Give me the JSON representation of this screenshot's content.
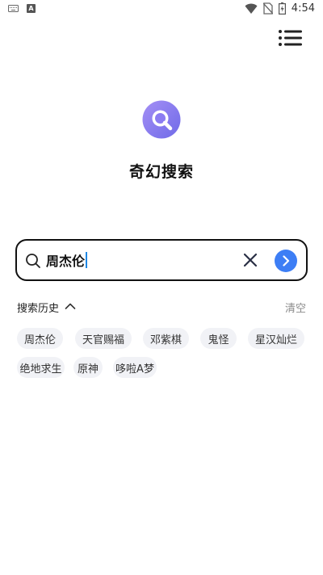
{
  "status_bar": {
    "left_icons": [
      "keyboard-icon",
      "a-icon"
    ],
    "a_icon_text": "A",
    "right_icons": [
      "wifi-icon",
      "no-sim-icon",
      "battery-charging-icon"
    ],
    "time": "4:54"
  },
  "header": {
    "menu_icon": "menu-icon"
  },
  "app": {
    "logo_icon": "search-logo-icon",
    "title": "奇幻搜索",
    "accent_color": "#3d7ef5",
    "logo_color": "#8b7cf2"
  },
  "search": {
    "value": "周杰伦",
    "icon": "search-icon",
    "clear_icon": "close-icon",
    "submit_icon": "arrow-right-icon"
  },
  "history": {
    "title": "搜索历史",
    "toggle_icon": "chevron-up-icon",
    "clear_label": "清空",
    "items": [
      "周杰伦",
      "天官赐福",
      "邓紫棋",
      "鬼怪",
      "星汉灿烂",
      "绝地求生",
      "原神",
      "哆啦A梦"
    ]
  }
}
